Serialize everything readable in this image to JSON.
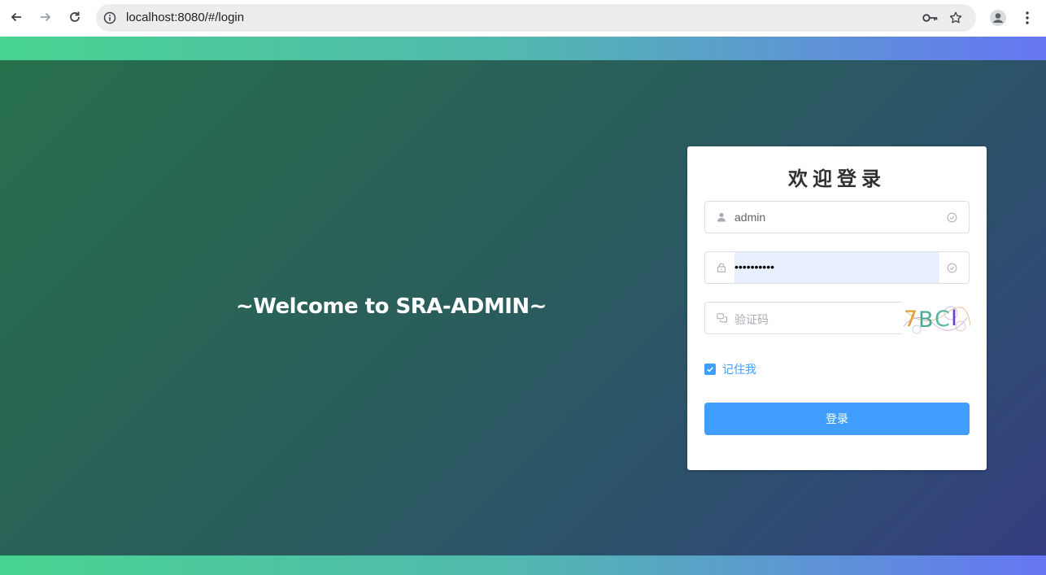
{
  "browser": {
    "url": "localhost:8080/#/login",
    "icons": [
      "back-icon",
      "forward-icon",
      "reload-icon",
      "site-info-icon",
      "password-key-icon",
      "bookmark-star-icon",
      "profile-icon",
      "menu-dots-icon"
    ]
  },
  "hero": {
    "welcome": "~Welcome to SRA-ADMIN~"
  },
  "login": {
    "title": "欢迎登录",
    "username_value": "admin",
    "password_value": "••••••••••",
    "captcha_placeholder": "验证码",
    "captcha_text": "7BCI",
    "remember_label": "记住我",
    "remember_checked": true,
    "submit_label": "登录"
  },
  "colors": {
    "primary": "#409eff",
    "banner_start": "#48d390",
    "banner_end": "#6677f3"
  }
}
